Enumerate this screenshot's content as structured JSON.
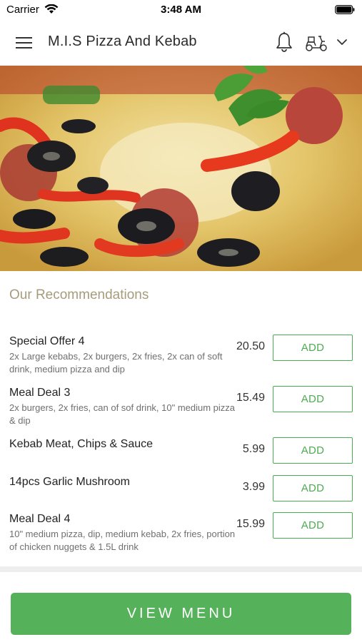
{
  "status_bar": {
    "carrier": "Carrier",
    "time": "3:48 AM"
  },
  "header": {
    "title": "M.I.S Pizza And Kebab",
    "icons": [
      "menu-icon",
      "bell-icon",
      "scooter-icon",
      "chevron-down-icon"
    ]
  },
  "hero": {
    "image": "pizza-photo"
  },
  "recommendations": {
    "title": "Our Recommendations",
    "add_label": "ADD",
    "items": [
      {
        "name": "Special Offer 4",
        "description": "2x Large kebabs, 2x burgers, 2x fries, 2x can of soft drink, medium pizza and dip",
        "price": "20.50"
      },
      {
        "name": "Meal Deal 3",
        "description": "2x burgers, 2x fries, can of sof drink, 10\" medium pizza & dip",
        "price": "15.49"
      },
      {
        "name": "Kebab Meat, Chips & Sauce",
        "description": "",
        "price": "5.99"
      },
      {
        "name": "14pcs Garlic Mushroom",
        "description": "",
        "price": "3.99"
      },
      {
        "name": "Meal Deal 4",
        "description": "10\" medium pizza, dip, medium kebab, 2x fries, portion of chicken nuggets & 1.5L drink",
        "price": "15.99"
      }
    ]
  },
  "footer": {
    "view_menu_label": "VIEW MENU"
  },
  "colors": {
    "accent_green": "#56b25a",
    "section_title": "#a69c7c"
  }
}
